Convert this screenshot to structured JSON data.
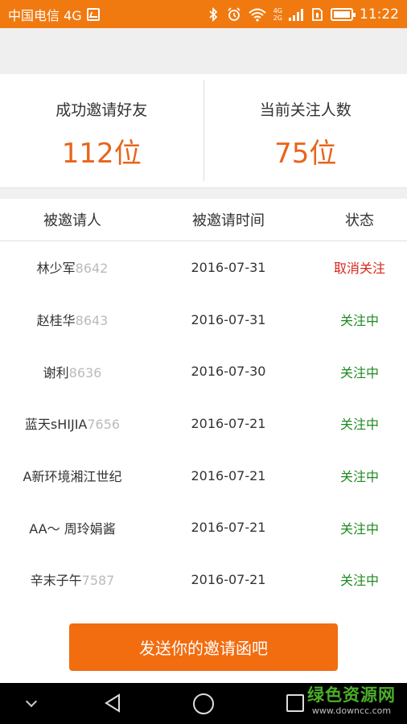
{
  "status_bar": {
    "carrier": "中国电信 4G",
    "network_top": "4G",
    "network_bottom": "2G",
    "time": "11:22"
  },
  "stats": {
    "invited_label": "成功邀请好友",
    "invited_value": "112位",
    "following_label": "当前关注人数",
    "following_value": "75位"
  },
  "table": {
    "headers": [
      "被邀请人",
      "被邀请时间",
      "状态"
    ],
    "rows": [
      {
        "name": "林少军",
        "code": "8642",
        "date": "2016-07-31",
        "status": "取消关注",
        "status_type": "cancel"
      },
      {
        "name": "赵桂华",
        "code": "8643",
        "date": "2016-07-31",
        "status": "关注中",
        "status_type": "follow"
      },
      {
        "name": "谢利",
        "code": "8636",
        "date": "2016-07-30",
        "status": "关注中",
        "status_type": "follow"
      },
      {
        "name": "蓝天sHIJIA",
        "code": "7656",
        "date": "2016-07-21",
        "status": "关注中",
        "status_type": "follow"
      },
      {
        "name": "A新环境湘江世纪",
        "code": "",
        "date": "2016-07-21",
        "status": "关注中",
        "status_type": "follow"
      },
      {
        "name": "AA～ 周玲娟酱",
        "code": "",
        "date": "2016-07-21",
        "status": "关注中",
        "status_type": "follow"
      },
      {
        "name": "辛末子午",
        "code": "7587",
        "date": "2016-07-21",
        "status": "关注中",
        "status_type": "follow"
      }
    ]
  },
  "cta_label": "发送你的邀请函吧",
  "watermark": {
    "title": "绿色资源网",
    "url": "www.downcc.com"
  },
  "colors": {
    "accent": "#f26c10",
    "value": "#e8641b",
    "cancel": "#d9261c",
    "follow": "#1f8a22"
  }
}
